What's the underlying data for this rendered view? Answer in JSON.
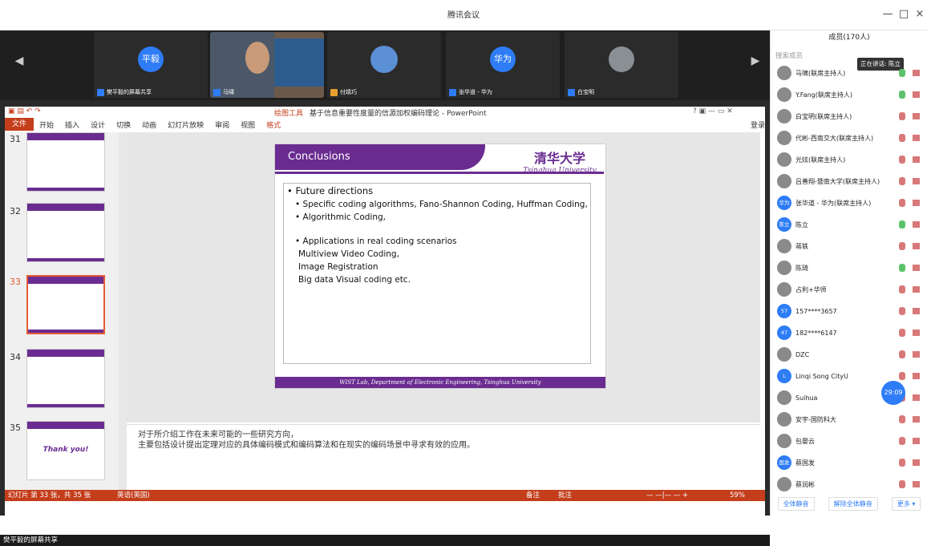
{
  "window": {
    "title": "腾讯会议",
    "min": "—",
    "max": "□",
    "close": "×"
  },
  "strip": {
    "tiles": [
      {
        "label": "樊平毅的屏幕共享",
        "avatar": "平毅",
        "type": "avatar"
      },
      {
        "label": "马啸",
        "avatar": "",
        "type": "video"
      },
      {
        "label": "付婧巧",
        "avatar": "",
        "type": "photo"
      },
      {
        "label": "张华道 - 华为",
        "avatar": "华为",
        "type": "avatar"
      },
      {
        "label": "白宝明",
        "avatar": "",
        "type": "photo"
      }
    ]
  },
  "ppt": {
    "title_tool": "绘图工具",
    "title": "基于信息重要性度量的信源加权编码理论 - PowerPoint",
    "login": "登录",
    "tabs": [
      "文件",
      "开始",
      "插入",
      "设计",
      "切换",
      "动画",
      "幻灯片放映",
      "审阅",
      "视图",
      "格式"
    ],
    "thumb_numbers": [
      "31",
      "32",
      "33",
      "34",
      "35"
    ],
    "thank_you": "Thank you!",
    "slide": {
      "heading": "Conclusions",
      "logo_cn": "清华大学",
      "logo_en": "Tsinghua University",
      "lines": [
        "• Future directions",
        "• Specific coding algorithms, Fano-Shannon Coding, Huffman Coding,",
        "• Algorithmic Coding,",
        "• Applications in real coding scenarios",
        "Multiview Video Coding,",
        "Image Registration",
        "Big data Visual coding  etc."
      ],
      "footer": "WIST Lab, Department of Electronic Engineering, Tsinghua University"
    },
    "notes": [
      "对于所介绍工作在未来可能的一些研究方向，",
      "主要包括设计提出定理对应的具体编码模式和编码算法和在现实的编码场景中寻求有效的应用。"
    ],
    "status": {
      "slide_info": "幻灯片 第 33 张，共 35 张",
      "lang": "英语(英国)",
      "notes_btn": "备注",
      "comments_btn": "批注",
      "zoom": "59%"
    }
  },
  "bottombar": {
    "label": "樊平毅的屏幕共享"
  },
  "members": {
    "header": "成员(170人)",
    "search_placeholder": "搜索成员",
    "speaking": "正在讲话: 陈立",
    "list": [
      {
        "name": "马啸(联席主持人)",
        "avatar": "",
        "mic": "on"
      },
      {
        "name": "Y.Fang(联席主持人)",
        "avatar": "",
        "mic": "on"
      },
      {
        "name": "白宝明(联席主持人)",
        "avatar": "",
        "mic": "off"
      },
      {
        "name": "代彬-西南交大(联席主持人)",
        "avatar": "",
        "mic": "off"
      },
      {
        "name": "光炫(联席主持人)",
        "avatar": "",
        "mic": "off"
      },
      {
        "name": "吕善翔-暨南大学(联席主持人)",
        "avatar": "",
        "mic": "off"
      },
      {
        "name": "张华道 - 华为(联席主持人)",
        "avatar": "华为",
        "mic": "off"
      },
      {
        "name": "陈立",
        "avatar": "陈立",
        "mic": "on"
      },
      {
        "name": "蒋轶",
        "avatar": "",
        "mic": "off"
      },
      {
        "name": "陈琦",
        "avatar": "",
        "mic": "on"
      },
      {
        "name": "占利+华师",
        "avatar": "",
        "mic": "off"
      },
      {
        "name": "157****3657",
        "avatar": "57",
        "mic": "off"
      },
      {
        "name": "182****6147",
        "avatar": "47",
        "mic": "off"
      },
      {
        "name": "DZC",
        "avatar": "",
        "mic": "off"
      },
      {
        "name": "Linqi Song CityU",
        "avatar": "L",
        "mic": "off"
      },
      {
        "name": "Suihua",
        "avatar": "",
        "mic": "off"
      },
      {
        "name": "安宇-国防科大",
        "avatar": "",
        "mic": "off"
      },
      {
        "name": "包晏云",
        "avatar": "",
        "mic": "off"
      },
      {
        "name": "蔡国发",
        "avatar": "国发",
        "mic": "off"
      },
      {
        "name": "蔡润彬",
        "avatar": "",
        "mic": "off"
      }
    ],
    "timer": "29:09",
    "buttons": {
      "mute_all": "全体静音",
      "unmute_all": "解除全体静音",
      "more": "更多 ▾"
    }
  }
}
